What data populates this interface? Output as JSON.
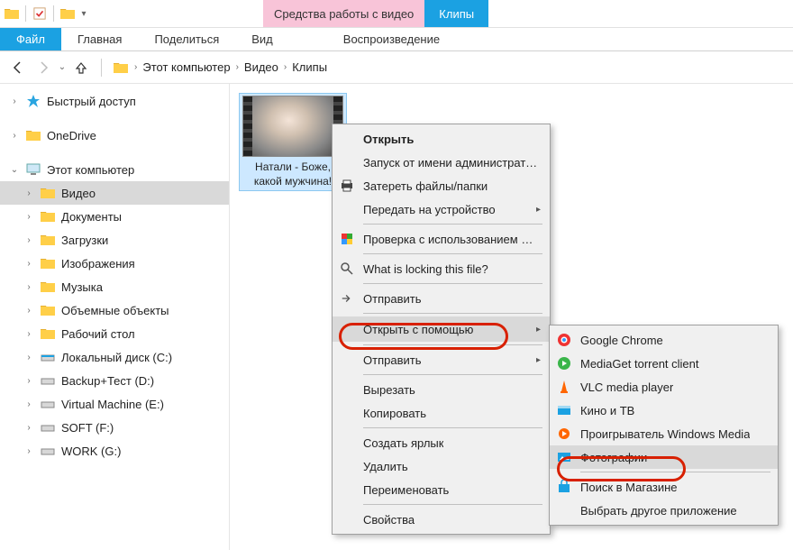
{
  "titlebar": {
    "video_tools": "Средства работы с видео",
    "window_title": "Клипы"
  },
  "ribbon": {
    "file": "Файл",
    "home": "Главная",
    "share": "Поделиться",
    "view": "Вид",
    "playback": "Воспроизведение"
  },
  "breadcrumb": {
    "root": "Этот компьютер",
    "videos": "Видео",
    "folder": "Клипы"
  },
  "sidebar": {
    "quick_access": "Быстрый доступ",
    "onedrive": "OneDrive",
    "this_pc": "Этот компьютер",
    "videos": "Видео",
    "documents": "Документы",
    "downloads": "Загрузки",
    "pictures": "Изображения",
    "music": "Музыка",
    "objects3d": "Объемные объекты",
    "desktop": "Рабочий стол",
    "local_c": "Локальный диск (C:)",
    "backup_d": "Backup+Тест (D:)",
    "vm_e": "Virtual Machine (E:)",
    "soft_f": "SOFT (F:)",
    "work_g": "WORK (G:)"
  },
  "file": {
    "name": "Натали - Боже, какой мужчина!"
  },
  "context_menu": {
    "open": "Открыть",
    "run_as_admin": "Запуск от имени администратора",
    "shred": "Затереть файлы/папки",
    "cast": "Передать на устройство",
    "defender": "Проверка с использованием Windows Defender...",
    "locking": "What is locking this file?",
    "send_to": "Отправить",
    "open_with": "Открыть с помощью",
    "send": "Отправить",
    "cut": "Вырезать",
    "copy": "Копировать",
    "shortcut": "Создать ярлык",
    "delete": "Удалить",
    "rename": "Переименовать",
    "properties": "Свойства"
  },
  "open_with_menu": {
    "chrome": "Google Chrome",
    "mediaget": "MediaGet torrent client",
    "vlc": "VLC media player",
    "movies_tv": "Кино и ТВ",
    "wmp": "Проигрыватель Windows Media",
    "photos": "Фотографии",
    "store": "Поиск в Магазине",
    "choose": "Выбрать другое приложение"
  }
}
